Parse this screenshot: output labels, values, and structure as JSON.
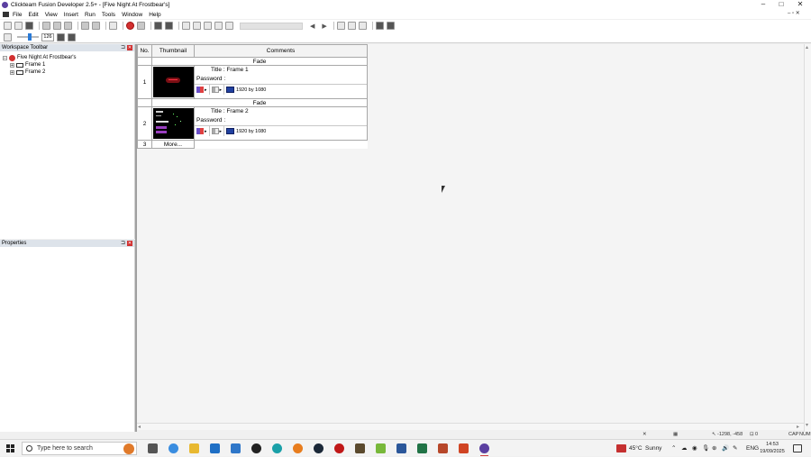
{
  "window": {
    "title": "Clickteam Fusion Developer 2.5+ - [Five Night At Frostbear's]",
    "controls": {
      "minimize": "–",
      "maximize": "□",
      "close": "✕"
    },
    "mdi_controls": "– ▫ ✕"
  },
  "menu": {
    "items": [
      "File",
      "Edit",
      "View",
      "Insert",
      "Run",
      "Tools",
      "Window",
      "Help"
    ]
  },
  "toolbar": {
    "zoom_value": "126",
    "nav_prev": "◀",
    "nav_next": "▶"
  },
  "workspace": {
    "title": "Workspace Toolbar",
    "pin": "⊐",
    "close": "✕",
    "tree": {
      "root": "Five Night At Frostbear's",
      "frames": [
        "Frame 1",
        "Frame 2"
      ],
      "root_expander": "−",
      "frame_expander": "+"
    }
  },
  "properties": {
    "title": "Properties",
    "pin": "⊐",
    "close": "✕"
  },
  "storyboard": {
    "headers": {
      "no": "No.",
      "thumbnail": "Thumbnail",
      "comments": "Comments"
    },
    "frames": [
      {
        "no": "1",
        "transition": "Fade",
        "title": "Title : Frame 1",
        "password": "Password :",
        "resolution": "1920 by 1080"
      },
      {
        "no": "2",
        "transition": "Fade",
        "title": "Title : Frame 2",
        "password": "Password :",
        "resolution": "1920 by 1080"
      }
    ],
    "more_no": "3",
    "more_label": "More..."
  },
  "statusbar": {
    "coords": "-1298, -458",
    "objects": "0",
    "caps": "CAP",
    "num": "NUM"
  },
  "taskbar": {
    "search_placeholder": "Type here to search",
    "temperature": "45°C",
    "weather": "Sunny",
    "language": "ENG",
    "time": "14:53",
    "date": "19/09/2025"
  },
  "colors": {
    "accent": "#2a7ad6",
    "close_red": "#d23030",
    "panel_header": "#dde3ea"
  }
}
